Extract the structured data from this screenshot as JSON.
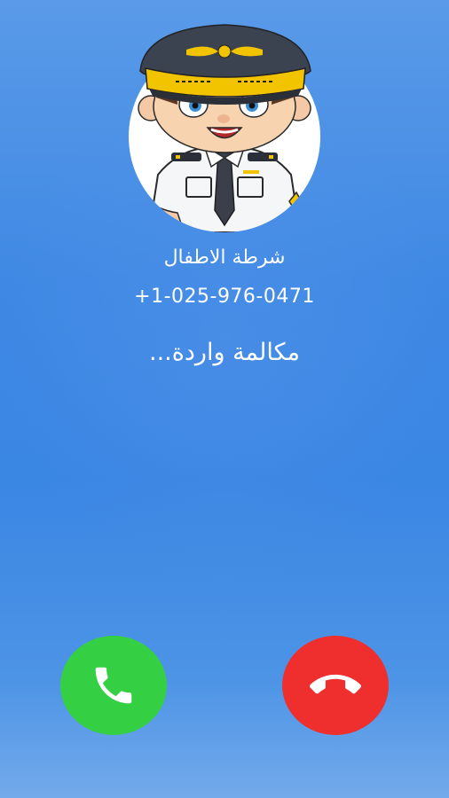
{
  "caller": {
    "name": "شرطة الاطفال",
    "number": "+1-025-976-0471",
    "avatar_icon": "police-boy-avatar"
  },
  "call": {
    "status": "مكالمة واردة..."
  },
  "actions": {
    "accept": {
      "icon": "phone-icon",
      "color": "#35cf44"
    },
    "decline": {
      "icon": "phone-hangup-icon",
      "color": "#ee2f2e"
    }
  },
  "colors": {
    "background": "#3f89e4",
    "text": "#ffffff"
  }
}
